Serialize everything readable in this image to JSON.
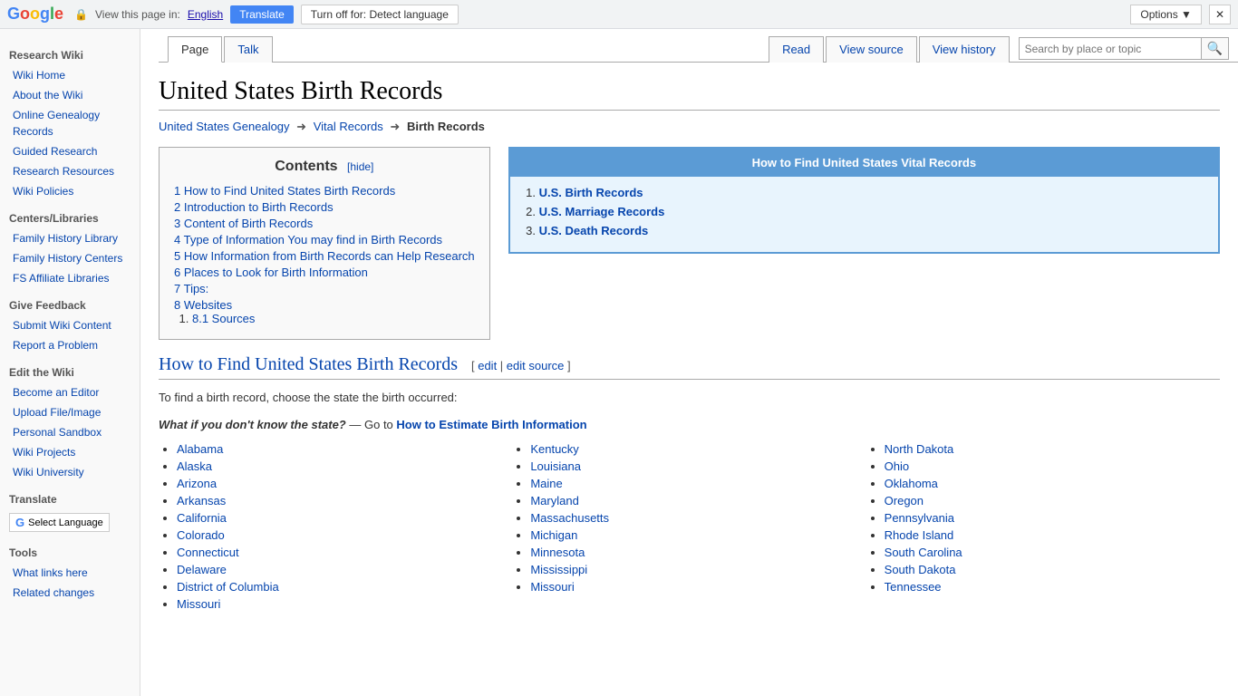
{
  "translate_bar": {
    "view_page_text": "View this page in:",
    "language": "English",
    "translate_btn": "Translate",
    "turnoff_btn": "Turn off for: Detect language",
    "options_btn": "Options ▼",
    "close_btn": "✕"
  },
  "sidebar": {
    "research_wiki_title": "Research Wiki",
    "sections": [
      {
        "label": "Wiki Home",
        "link": "#"
      },
      {
        "label": "About the Wiki",
        "link": "#"
      },
      {
        "label": "Online Genealogy Records",
        "link": "#"
      },
      {
        "label": "Guided Research",
        "link": "#"
      },
      {
        "label": "Research Resources",
        "link": "#"
      },
      {
        "label": "Wiki Policies",
        "link": "#"
      }
    ],
    "centers_title": "Centers/Libraries",
    "centers": [
      {
        "label": "Family History Library",
        "link": "#"
      },
      {
        "label": "Family History Centers",
        "link": "#"
      },
      {
        "label": "FS Affiliate Libraries",
        "link": "#"
      }
    ],
    "feedback_title": "Give Feedback",
    "feedback": [
      {
        "label": "Submit Wiki Content",
        "link": "#"
      },
      {
        "label": "Report a Problem",
        "link": "#"
      }
    ],
    "edit_title": "Edit the Wiki",
    "edit": [
      {
        "label": "Become an Editor",
        "link": "#"
      },
      {
        "label": "Upload File/Image",
        "link": "#"
      },
      {
        "label": "Personal Sandbox",
        "link": "#"
      },
      {
        "label": "Wiki Projects",
        "link": "#"
      },
      {
        "label": "Wiki University",
        "link": "#"
      }
    ],
    "translate_title": "Translate",
    "select_language": "Select Language",
    "tools_title": "Tools",
    "tools": [
      {
        "label": "What links here",
        "link": "#"
      },
      {
        "label": "Related changes",
        "link": "#"
      }
    ]
  },
  "page": {
    "title": "United States Birth Records",
    "tabs": [
      {
        "label": "Page",
        "active": true
      },
      {
        "label": "Talk",
        "active": false
      }
    ],
    "actions": [
      {
        "label": "Read"
      },
      {
        "label": "View source"
      },
      {
        "label": "View history"
      }
    ],
    "search_placeholder": "Search by place or topic"
  },
  "breadcrumb": {
    "items": [
      {
        "label": "United States Genealogy",
        "link": "#"
      },
      {
        "label": "Vital Records",
        "link": "#"
      },
      {
        "label": "Birth Records",
        "current": true
      }
    ]
  },
  "contents": {
    "title": "Contents",
    "hide_label": "[hide]",
    "items": [
      {
        "num": "1",
        "label": "How to Find United States Birth Records",
        "link": "#find"
      },
      {
        "num": "2",
        "label": "Introduction to Birth Records",
        "link": "#intro"
      },
      {
        "num": "3",
        "label": "Content of Birth Records",
        "link": "#content"
      },
      {
        "num": "4",
        "label": "Type of Information You may find in Birth Records",
        "link": "#type"
      },
      {
        "num": "5",
        "label": "How Information from Birth Records can Help Research",
        "link": "#help"
      },
      {
        "num": "6",
        "label": "Places to Look for Birth Information",
        "link": "#places"
      },
      {
        "num": "7",
        "label": "Tips:",
        "link": "#tips"
      },
      {
        "num": "8",
        "label": "Websites",
        "link": "#websites",
        "sub": [
          {
            "num": "8.1",
            "label": "Sources",
            "link": "#sources"
          }
        ]
      }
    ]
  },
  "infobox": {
    "title": "How to Find United States Vital Records",
    "items": [
      {
        "label": "U.S. Birth Records",
        "link": "#"
      },
      {
        "label": "U.S. Marriage Records",
        "link": "#"
      },
      {
        "label": "U.S. Death Records",
        "link": "#"
      }
    ]
  },
  "section_find": {
    "heading": "How to Find United States Birth Records",
    "edit_label": "[ edit | edit source ]",
    "intro": "To find a birth record, choose the state the birth occurred:",
    "italic_text": "What if you don't know the state?",
    "dash_text": " — Go to ",
    "estimate_link": "How to Estimate Birth Information"
  },
  "states": {
    "col1": [
      "Alabama",
      "Alaska",
      "Arizona",
      "Arkansas",
      "California",
      "Colorado",
      "Connecticut",
      "Delaware",
      "District of Columbia",
      "Missouri"
    ],
    "col2": [
      "Kentucky",
      "Louisiana",
      "Maine",
      "Maryland",
      "Massachusetts",
      "Michigan",
      "Minnesota",
      "Mississippi",
      "Missouri"
    ],
    "col3": [
      "North Dakota",
      "Ohio",
      "Oklahoma",
      "Oregon",
      "Pennsylvania",
      "Rhode Island",
      "South Carolina",
      "South Dakota",
      "Tennessee"
    ]
  }
}
